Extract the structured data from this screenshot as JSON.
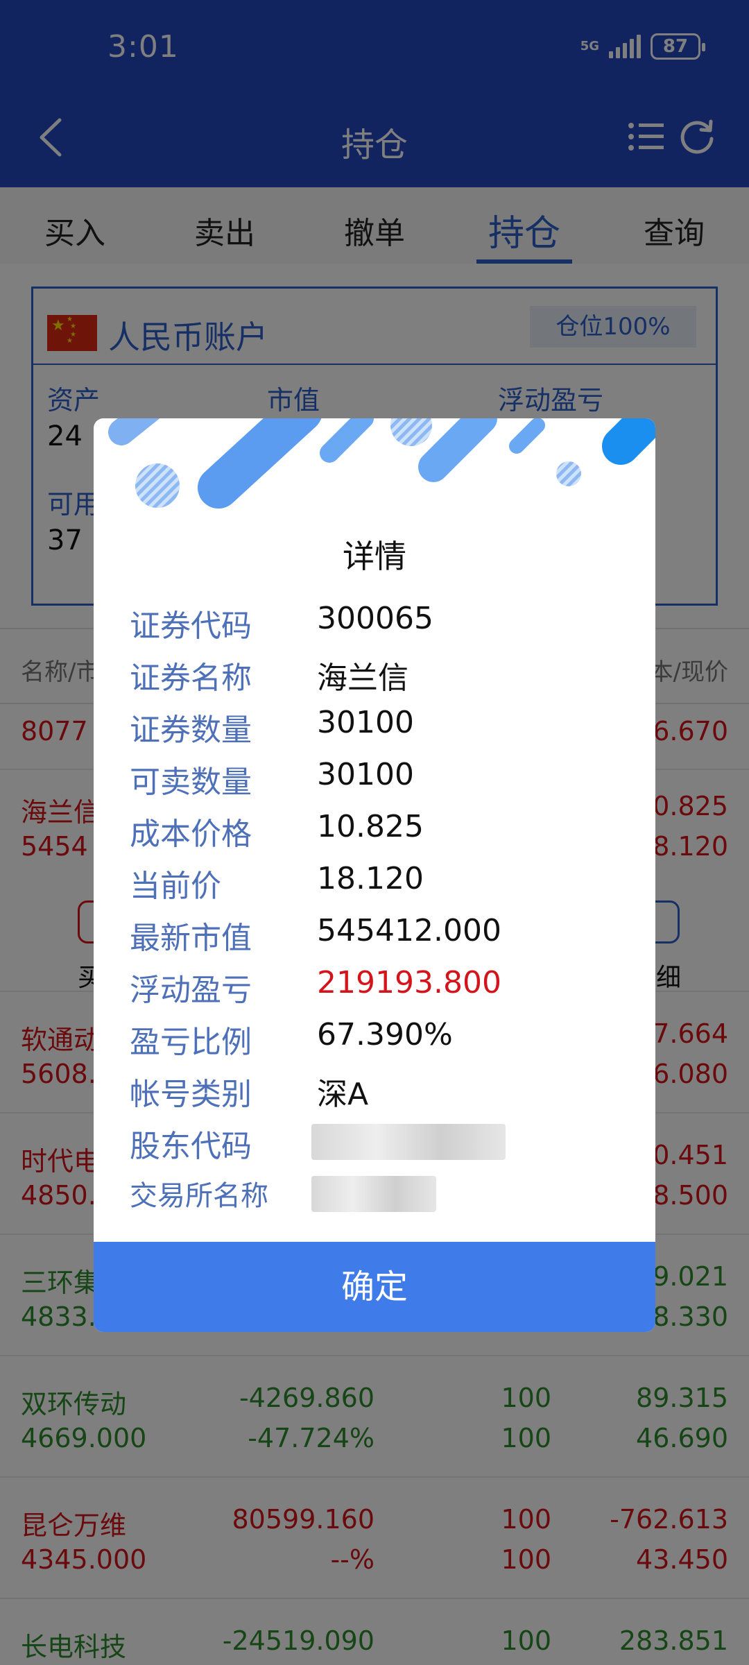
{
  "status_bar": {
    "time": "3:01",
    "network": "5G",
    "battery": "87"
  },
  "header": {
    "title": "持仓",
    "icons": [
      "back-icon",
      "list-icon",
      "refresh-icon"
    ]
  },
  "tabs": [
    {
      "label": "买入",
      "active": false
    },
    {
      "label": "卖出",
      "active": false
    },
    {
      "label": "撤单",
      "active": false
    },
    {
      "label": "持仓",
      "active": true
    },
    {
      "label": "查询",
      "active": false
    }
  ],
  "account": {
    "title": "人民币账户",
    "position": "仓位100%",
    "stats": [
      {
        "label": "资产",
        "value": "24"
      },
      {
        "label": "市值",
        "value": ""
      },
      {
        "label": "浮动盈亏",
        "value": ""
      },
      {
        "label": "可用",
        "value": "37"
      }
    ]
  },
  "holdings_header": {
    "left": "名称/市",
    "right": "本/现价"
  },
  "holdings": [
    {
      "name": "",
      "mkt": "8077",
      "pnl": "",
      "pct": "",
      "qty": "",
      "avail": "",
      "cost": "",
      "price": "6.670",
      "color": "red"
    },
    {
      "name": "海兰信",
      "mkt": "5454",
      "pnl": "",
      "pct": "",
      "qty": "",
      "avail": "",
      "cost": "0.825",
      "price": "8.120",
      "color": "red"
    },
    {
      "name": "软通动",
      "mkt": "5608.",
      "pnl": "",
      "pct": "",
      "qty": "",
      "avail": "",
      "cost": "7.664",
      "price": "6.080",
      "color": "red"
    },
    {
      "name": "时代电",
      "mkt": "4850.",
      "pnl": "",
      "pct": "",
      "qty": "",
      "avail": "",
      "cost": "0.451",
      "price": "8.500",
      "color": "red"
    },
    {
      "name": "三环集",
      "mkt": "4833.",
      "pnl": "",
      "pct": "",
      "qty": "",
      "avail": "",
      "cost": "9.021",
      "price": "8.330",
      "color": "green"
    },
    {
      "name": "双环传动",
      "mkt": "4669.000",
      "pnl": "-4269.860",
      "pct": "-47.724%",
      "qty": "100",
      "avail": "100",
      "cost": "89.315",
      "price": "46.690",
      "color": "green"
    },
    {
      "name": "昆仑万维",
      "mkt": "4345.000",
      "pnl": "80599.160",
      "pct": "--%",
      "qty": "100",
      "avail": "100",
      "cost": "-762.613",
      "price": "43.450",
      "color": "red"
    },
    {
      "name": "长电科技",
      "mkt": "",
      "pnl": "-24519.090",
      "pct": "",
      "qty": "100",
      "avail": "",
      "cost": "283.851",
      "price": "",
      "color": "green"
    }
  ],
  "actions": {
    "buy": "买",
    "detail": "细"
  },
  "dialog": {
    "title": "详情",
    "rows": [
      {
        "label": "证券代码",
        "value": "300065"
      },
      {
        "label": "证券名称",
        "value": "海兰信"
      },
      {
        "label": "证券数量",
        "value": "30100"
      },
      {
        "label": "可卖数量",
        "value": "30100"
      },
      {
        "label": "成本价格",
        "value": "10.825"
      },
      {
        "label": "当前价",
        "value": "18.120"
      },
      {
        "label": "最新市值",
        "value": "545412.000"
      },
      {
        "label": "浮动盈亏",
        "value": "219193.800",
        "color": "red"
      },
      {
        "label": "盈亏比例",
        "value": "67.390%"
      },
      {
        "label": "帐号类别",
        "value": "深A"
      },
      {
        "label": "股东代码",
        "value": ""
      },
      {
        "label": "交易所名称",
        "value": ""
      }
    ],
    "confirm": "确定"
  },
  "colors": {
    "brand_blue": "#2349bf",
    "accent_blue": "#2c5fc9",
    "confirm_blue": "#3f7ce9",
    "profit_red": "#d4141b",
    "loss_green": "#2c8a2c"
  }
}
